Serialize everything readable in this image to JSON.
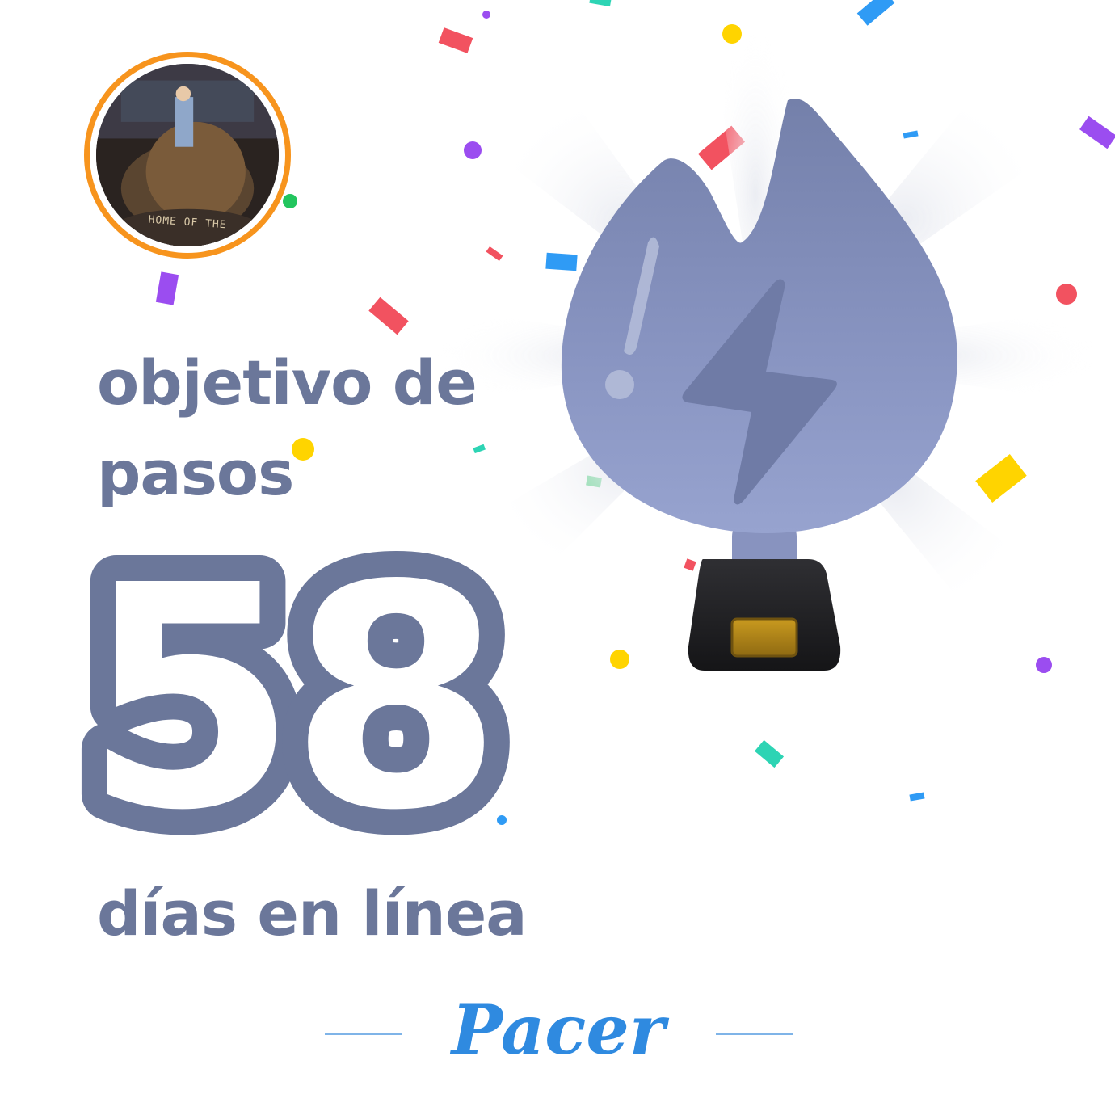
{
  "achievement": {
    "title_line1": "objetivo de",
    "title_line2": "pasos",
    "count": "58",
    "unit_label": "días en línea"
  },
  "brand": {
    "name": "Pacer"
  },
  "avatar": {
    "photo_caption": "HOME OF THE"
  },
  "trophy": {
    "icon": "lightning-bolt-icon",
    "flame_color": "#8390b8",
    "base_color": "#2b2b2e",
    "plate_color": "#b8860b"
  },
  "colors": {
    "text_primary": "#6b779a",
    "brand_blue": "#2f8ae0",
    "avatar_ring": "#f7941d"
  }
}
